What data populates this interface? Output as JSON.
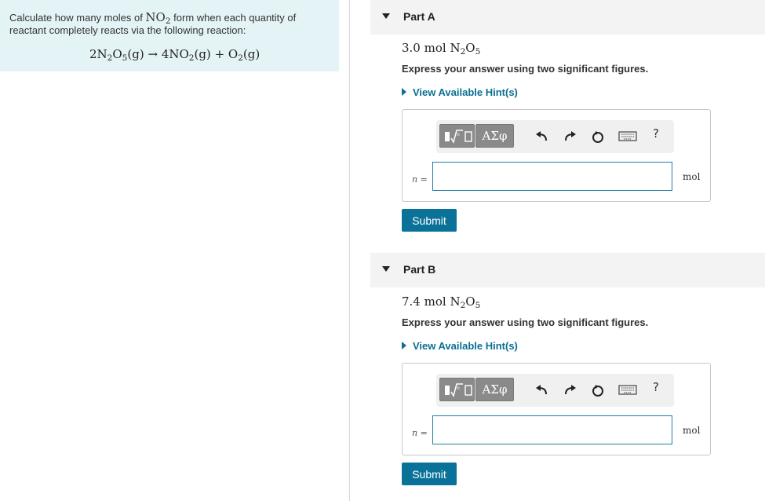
{
  "problem": {
    "text_before": "Calculate how many moles of ",
    "compound": "NO",
    "compound_sub": "2",
    "text_after": " form when each quantity of reactant completely reacts via the following reaction:",
    "equation": {
      "r1": "2N",
      "r1_sub1": "2",
      "r1_mid": "O",
      "r1_sub2": "5",
      "r1_state": "(g)",
      "arrow": "→",
      "p1": "4NO",
      "p1_sub": "2",
      "p1_state": "(g)",
      "plus": "+",
      "p2": "O",
      "p2_sub": "2",
      "p2_state": "(g)"
    }
  },
  "parts": [
    {
      "title": "Part A",
      "qty_value": "3.0 mol N",
      "qty_sub1": "2",
      "qty_mid": "O",
      "qty_sub2": "5",
      "instruction": "Express your answer using two significant figures.",
      "hint": "View Available Hint(s)",
      "greek": "ΑΣφ",
      "help": "?",
      "var": "n",
      "eq": " =",
      "input_value": "",
      "unit": "mol",
      "submit": "Submit"
    },
    {
      "title": "Part B",
      "qty_value": "7.4 mol N",
      "qty_sub1": "2",
      "qty_mid": "O",
      "qty_sub2": "5",
      "instruction": "Express your answer using two significant figures.",
      "hint": "View Available Hint(s)",
      "greek": "ΑΣφ",
      "help": "?",
      "var": "n",
      "eq": " =",
      "input_value": "",
      "unit": "mol",
      "submit": "Submit"
    }
  ],
  "colors": {
    "accent": "#0a7299",
    "hint": "#0a6f93",
    "problem_bg": "#e4f3f5"
  },
  "icons": [
    "template-sqrt-icon",
    "undo-icon",
    "redo-icon",
    "reset-icon",
    "keyboard-icon",
    "help-icon"
  ]
}
